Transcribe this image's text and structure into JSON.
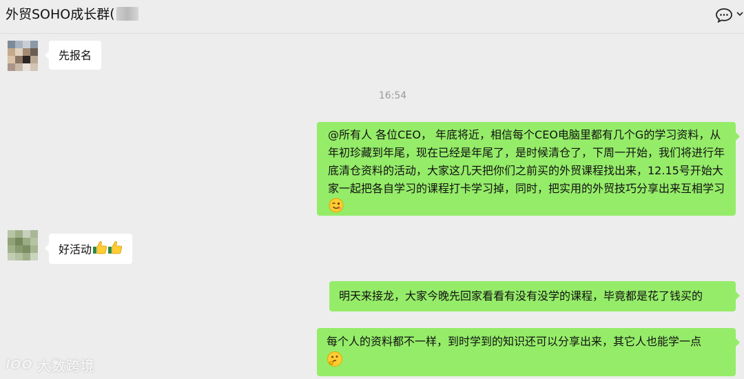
{
  "header": {
    "title": "外贸SOHO成长群",
    "title_paren": "(",
    "chat_icon": "chat-bubble-icon",
    "dropdown_icon": "chevron-down-icon"
  },
  "messages": [
    {
      "side": "in",
      "text": "先报名"
    },
    {
      "side": "out",
      "text": "@所有人 各位CEO， 年底将近，相信每个CEO电脑里都有几个G的学习资料，从年初珍藏到年尾，现在已经是年尾了，是时候清仓了，下周一开始，我们将进行年底清仓资料的活动，大家这几天把你们之前买的外贸课程找出来，12.15号开始大家一起把各自学习的课程打卡学习掉，同时，把实用的外贸技巧分享出来互相学习",
      "emoji": "wink-emoji"
    },
    {
      "side": "in",
      "text": "好活动",
      "emoji": "thumbs-up-emoji"
    },
    {
      "side": "out",
      "text": "明天来接龙，大家今晚先回家看看有没有没学的课程，毕竟都是花了钱买的"
    },
    {
      "side": "out",
      "text": "每个人的资料都不一样，到时学到的知识还可以分享出来，其它人也能学一点",
      "emoji": "thinking-emoji"
    }
  ],
  "timestamp": "16:54",
  "watermark": {
    "text": "大数跨境",
    "logo_text": "lOO"
  }
}
